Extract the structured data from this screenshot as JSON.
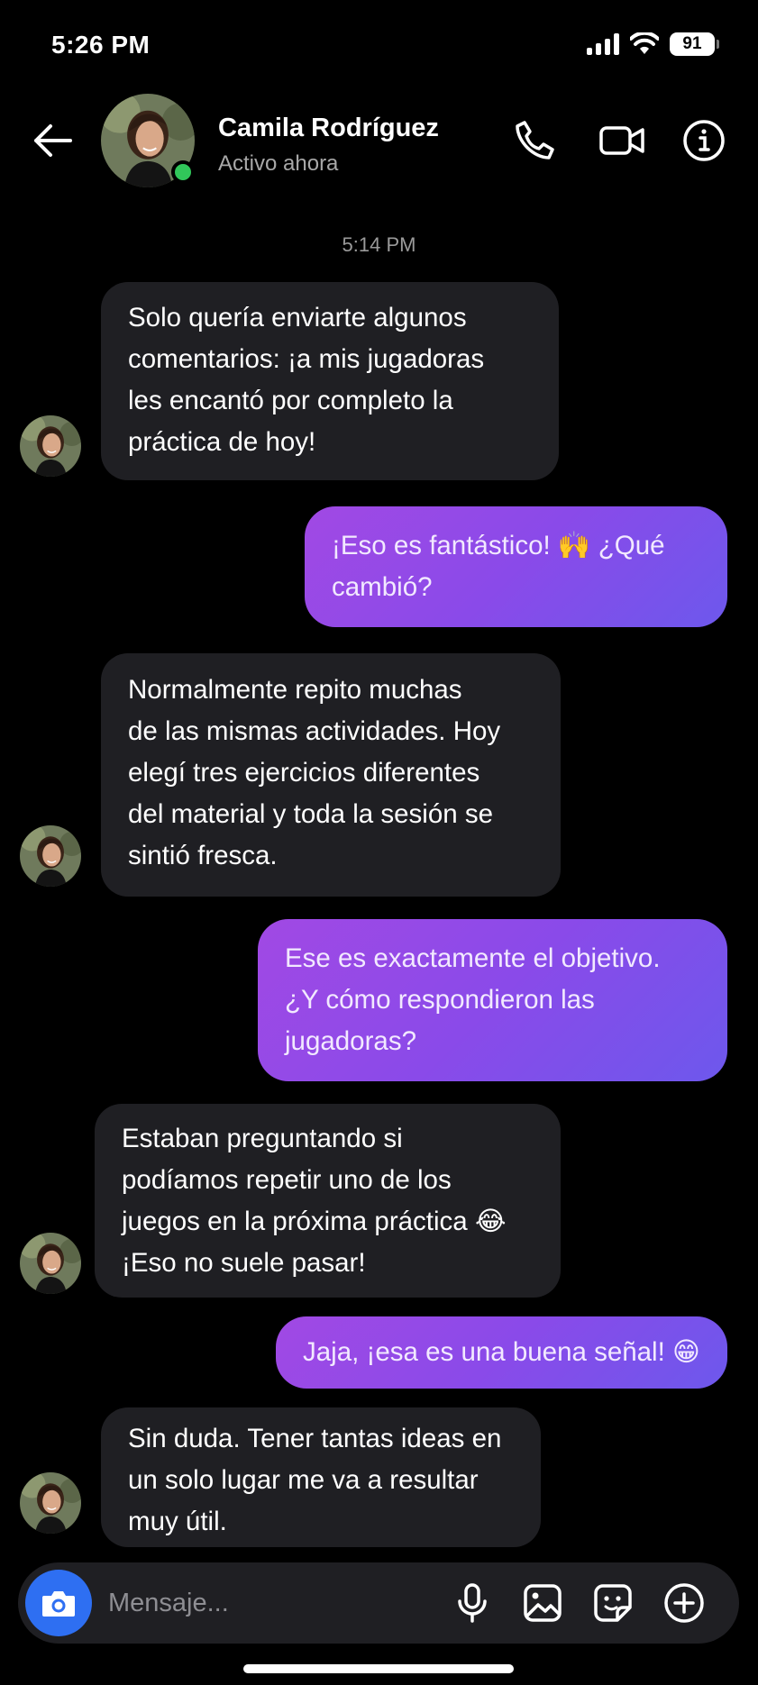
{
  "status_bar": {
    "time": "5:26 PM",
    "battery": "91"
  },
  "header": {
    "contact_name": "Camila Rodríguez",
    "contact_status": "Activo ahora",
    "icons": [
      "back-arrow-icon",
      "phone-icon",
      "video-camera-icon",
      "info-icon"
    ]
  },
  "chat": {
    "timestamp": "5:14 PM",
    "messages": [
      {
        "from": "contact",
        "lines": [
          "Solo quería enviarte algunos",
          "comentarios: ¡a mis jugadoras",
          "les encantó por completo la",
          "práctica de hoy!"
        ]
      },
      {
        "from": "me",
        "lines": [
          "¡Eso es fantástico! 🙌 ¿Qué",
          "cambió?"
        ]
      },
      {
        "from": "contact",
        "lines": [
          "Normalmente repito muchas",
          "de las mismas actividades. Hoy",
          "elegí tres ejercicios diferentes",
          "del material y toda la sesión se",
          "sintió fresca."
        ]
      },
      {
        "from": "me",
        "lines": [
          "Ese es exactamente el objetivo.",
          "¿Y cómo respondieron las",
          "jugadoras?"
        ]
      },
      {
        "from": "contact",
        "lines": [
          "Estaban preguntando si",
          "podíamos repetir uno de los",
          "juegos en la próxima práctica 😂",
          "¡Eso no suele pasar!"
        ]
      },
      {
        "from": "me",
        "lines": [
          "Jaja, ¡esa es una buena señal! 😁"
        ]
      },
      {
        "from": "contact",
        "lines": [
          "Sin duda. Tener tantas ideas en",
          "un solo lugar me va a resultar",
          "muy útil."
        ]
      }
    ]
  },
  "composer": {
    "placeholder": "Mensaje...",
    "icons": [
      "camera-icon",
      "microphone-icon",
      "gallery-icon",
      "sticker-icon",
      "plus-icon"
    ]
  },
  "colors": {
    "background": "#000000",
    "incoming_bubble": "#1f1f23",
    "outgoing_gradient_start": "#a149e4",
    "outgoing_gradient_end": "#6d58ec",
    "online": "#31c75a",
    "camera_button": "#2e6ff2"
  }
}
